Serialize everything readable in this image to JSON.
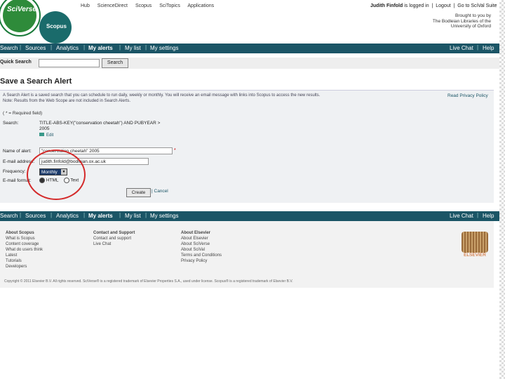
{
  "logos": {
    "sciverse": "SciVerse",
    "scopus": "Scopus"
  },
  "top_nav": [
    "Hub",
    "ScienceDirect",
    "Scopus",
    "SciTopics",
    "Applications"
  ],
  "user": {
    "name": "Judith Finfold",
    "status": "is logged in",
    "logout": "Logout",
    "goto": "Go to SciVal Suite",
    "brought_by": [
      "Brought to you by",
      "The Bodleian Libraries of the",
      "University of Oxford"
    ]
  },
  "main_nav": {
    "search": "Search",
    "sources": "Sources",
    "analytics": "Analytics",
    "alerts": "My alerts",
    "list": "My list",
    "settings": "My settings",
    "livechat": "Live Chat",
    "help": "Help"
  },
  "quick_search": {
    "label": "Quick Search",
    "button": "Search"
  },
  "page_title": "Save a Search Alert",
  "panel": {
    "description": "A Search Alert is a saved search that you can schedule to run daily, weekly or monthly. You will receive an email message with links into Scopus to access the new results.",
    "description2": "Note: Results from the Web Scope are not included in Search Alerts.",
    "privacy_link": "Read Privacy Policy",
    "required": "( * = Required field)",
    "search_label": "Search:",
    "search_value": "TITLE-ABS-KEY(\"conservation cheetah\") AND PUBYEAR >",
    "search_value_year": "2005",
    "edit_label": "Edit",
    "name_label": "Name of alert:",
    "name_value": "\"conservation cheetah\" 2005",
    "email_label": "E-mail address:",
    "email_value": "judith.finfold@bodleian.ox.ac.uk",
    "frequency_label": "Frequency:",
    "frequency_value": "Monthly",
    "format_label": "E-mail format:",
    "format_html": "HTML",
    "format_text": "Text",
    "create_button": "Create",
    "cancel_link": "Cancel"
  },
  "footer": {
    "about_scopus": {
      "title": "About Scopus",
      "items": [
        "What is Scopus",
        "Content coverage",
        "What do users think",
        "Latest",
        "Tutorials",
        "Developers"
      ]
    },
    "contact": {
      "title": "Contact and Support",
      "items": [
        "Contact and support",
        "Live Chat"
      ]
    },
    "about_elsevier": {
      "title": "About Elsevier",
      "items": [
        "About Elsevier",
        "About SciVerse",
        "About SciVal",
        "Terms and Conditions",
        "Privacy Policy"
      ]
    },
    "elsevier_logo": "ELSEVIER",
    "copyright": "Copyright © 2011 Elsevier B.V. All rights reserved. SciVerse® is a registered trademark of Elsevier Properties S.A., used under license. Scopus® is a registered trademark of Elsevier B.V."
  },
  "colors": {
    "nav_bar": "#1b5566",
    "annotation": "#d42a2a",
    "sciverse_green": "#2e8b3a",
    "scopus_teal": "#1a6b6b"
  }
}
